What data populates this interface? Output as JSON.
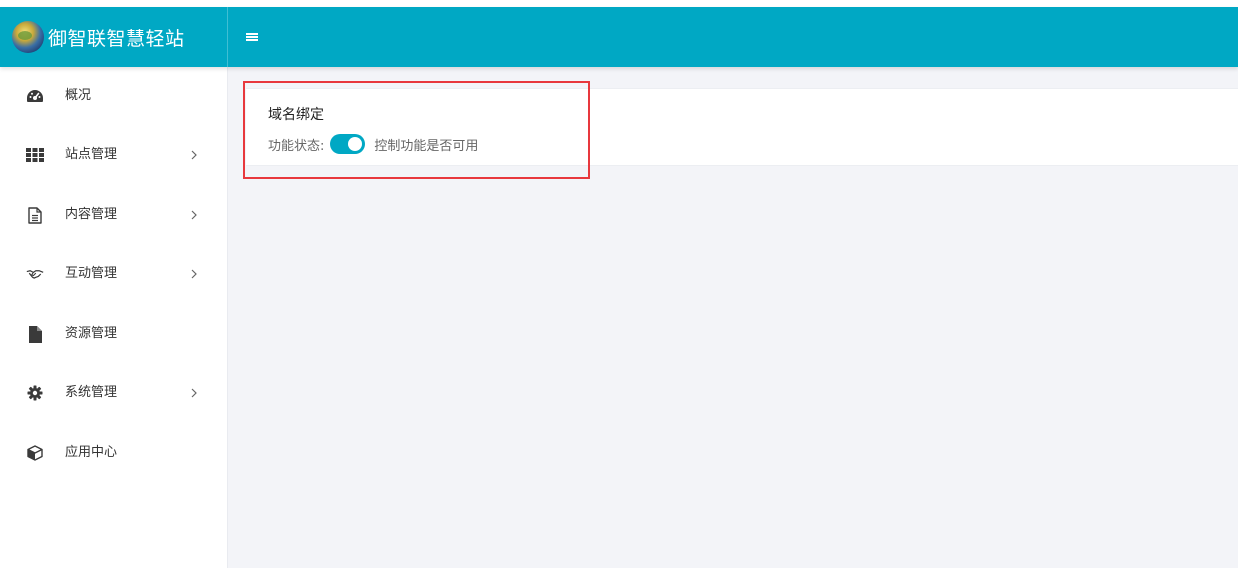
{
  "header": {
    "app_title": "御智联智慧轻站",
    "menu_toggle_icon": "hamburger-icon",
    "background_color": "#00a8c4"
  },
  "sidebar": {
    "items": [
      {
        "label": "概况",
        "icon": "dashboard-gauge-icon",
        "has_children": false
      },
      {
        "label": "站点管理",
        "icon": "grid-apps-icon",
        "has_children": true
      },
      {
        "label": "内容管理",
        "icon": "document-icon",
        "has_children": true
      },
      {
        "label": "互动管理",
        "icon": "handshake-icon",
        "has_children": true
      },
      {
        "label": "资源管理",
        "icon": "file-icon",
        "has_children": false
      },
      {
        "label": "系统管理",
        "icon": "gear-icon",
        "has_children": true
      },
      {
        "label": "应用中心",
        "icon": "cube-icon",
        "has_children": false
      }
    ]
  },
  "main": {
    "card": {
      "title": "域名绑定",
      "status_label": "功能状态:",
      "switch_on": true,
      "status_description": "控制功能是否可用"
    }
  },
  "colors": {
    "accent": "#00a8c4",
    "highlight_border": "#e8383d"
  }
}
